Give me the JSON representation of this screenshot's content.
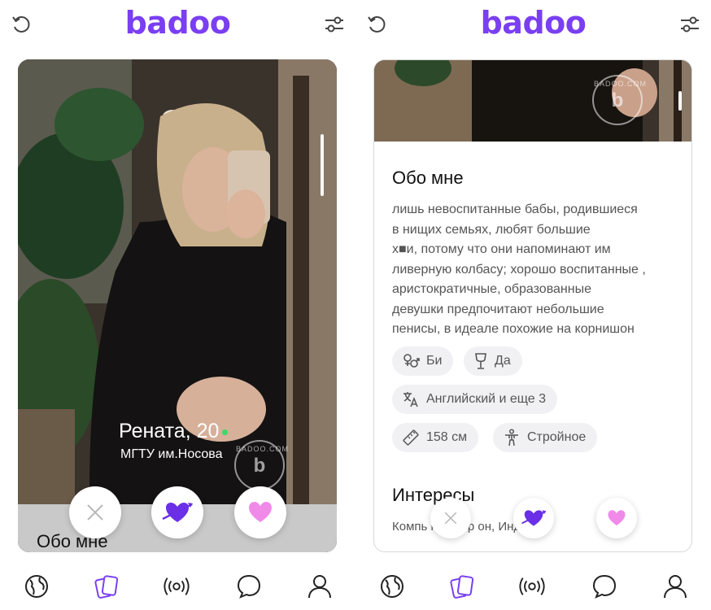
{
  "app": {
    "logo_text": "badoo",
    "brand_color": "#7a3ff2",
    "like_color": "#f08ae9"
  },
  "left_screen": {
    "topbar": {
      "undo_icon": "undo-icon",
      "filter_icon": "filter-icon"
    },
    "profile": {
      "name_age": "Рената, 20",
      "online": true,
      "school": "МГТУ им.Носова"
    },
    "about_peek": "Обо мне",
    "watermark": {
      "top": "BADOO.COM",
      "letter": "b"
    },
    "actions": {
      "dislike_icon": "close-icon",
      "crush_icon": "heart-arrow-icon",
      "like_icon": "heart-icon"
    }
  },
  "right_screen": {
    "about": {
      "title": "Обо мне",
      "text": "лишь невоспитанные бабы, родившиеся\nв нищих семьях, любят большие\nх■и, потому что они напоминают им\nливерную колбасу; хорошо воспитанные ,\nаристократичные, образованные\nдевушки предпочитают небольшие\nпенисы, в идеале похожие на корнишон"
    },
    "chips": [
      {
        "icon": "gender-icon",
        "label": "Би"
      },
      {
        "icon": "wine-glass-icon",
        "label": "Да"
      },
      {
        "icon": "translate-icon",
        "label": "Английский и еще 3"
      },
      {
        "icon": "ruler-icon",
        "label": "158 см"
      },
      {
        "icon": "body-icon",
        "label": "Стройное"
      }
    ],
    "interests": {
      "title": "Интересы",
      "text": "Компь      ные игр     он, Инд"
    },
    "watermark": {
      "top": "BADOO.COM",
      "letter": "b"
    }
  },
  "navbar": {
    "items": [
      {
        "icon": "globe-icon",
        "active": false
      },
      {
        "icon": "cards-icon",
        "active": true
      },
      {
        "icon": "broadcast-icon",
        "active": false
      },
      {
        "icon": "chat-icon",
        "active": false
      },
      {
        "icon": "profile-icon",
        "active": false
      }
    ]
  }
}
